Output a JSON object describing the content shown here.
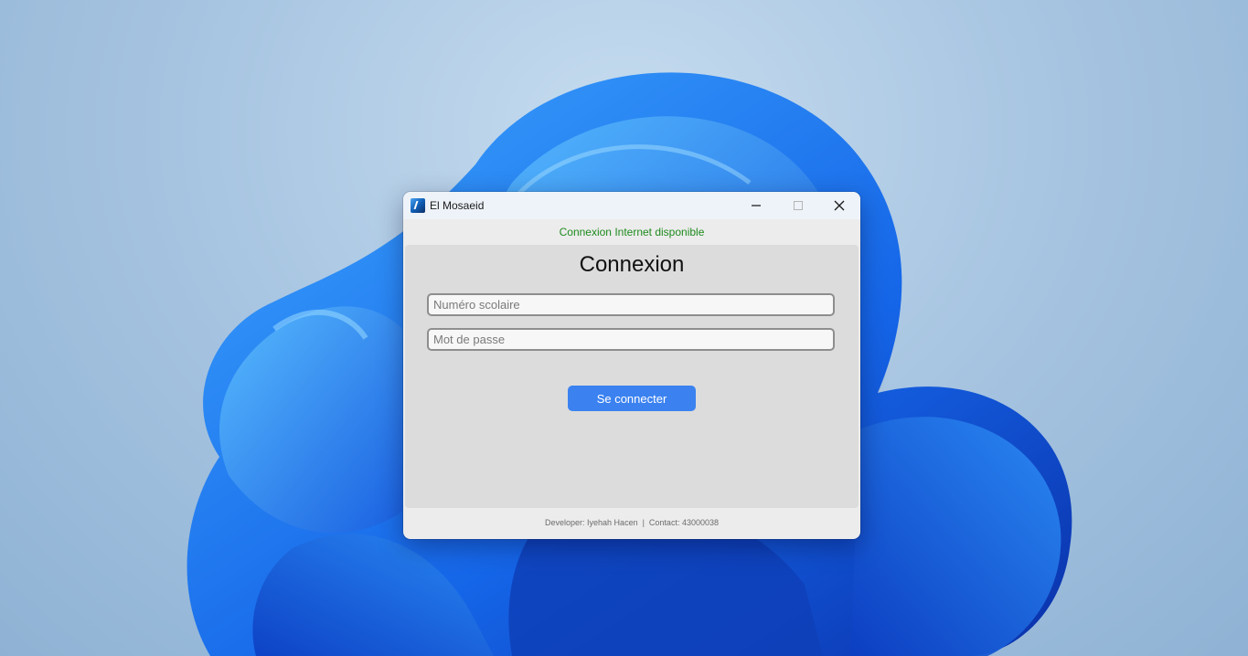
{
  "window": {
    "title": "El Mosaeid",
    "icon": "app-logo-icon",
    "controls": [
      "minimize-icon",
      "maximize-icon",
      "close-icon"
    ]
  },
  "status": {
    "text": "Connexion Internet disponible",
    "color": "#1e8a1e"
  },
  "login": {
    "title": "Connexion",
    "student_number_placeholder": "Numéro scolaire",
    "password_placeholder": "Mot de passe",
    "submit_label": "Se connecter",
    "accent": "#3b82f0"
  },
  "footer": {
    "developer": "Developer: Iyehah Hacen",
    "separator": "  |  ",
    "contact": "Contact: 43000038"
  }
}
